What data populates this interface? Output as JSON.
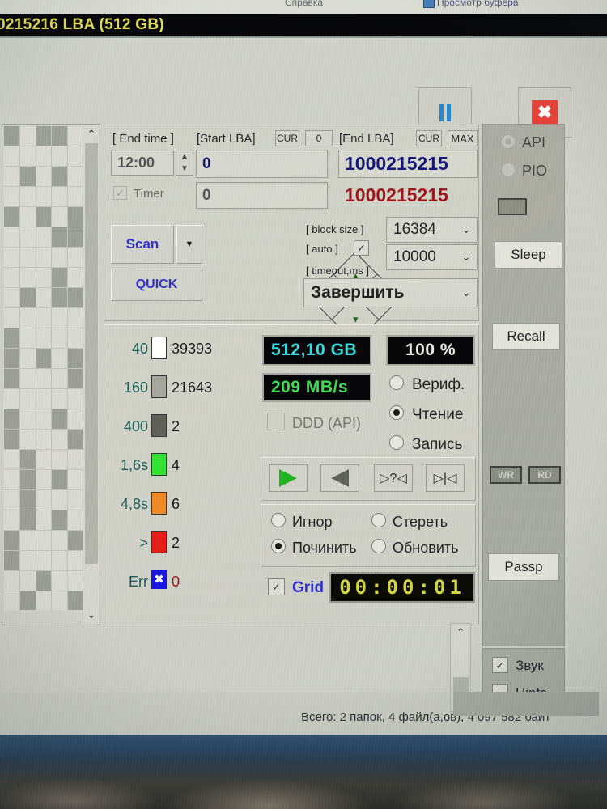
{
  "menu": {
    "help_label": "Справка",
    "buffer_label": "Просмотр буфера"
  },
  "titlebar": {
    "lba_text": "0215216 LBA (512 GB)"
  },
  "toolbar": {
    "pause_label": "Пауза",
    "stop_label": "Стоп",
    "pause_icon": "pause-icon",
    "stop_icon": "close-x-icon"
  },
  "scroll": {
    "up_glyph": "⌃",
    "down_glyph": "⌄"
  },
  "top_group": {
    "end_time_label": "[ End time ]",
    "end_time_value": "12:00",
    "timer_label": "Timer",
    "timer_checked": true,
    "start_lba_label": "[Start LBA]",
    "start_cur_label": "CUR",
    "start_zero_label": "0",
    "start_lba_value": "0",
    "start_lba_value2": "0",
    "end_lba_label": "[End LBA]",
    "end_cur_label": "CUR",
    "end_max_label": "MAX",
    "end_lba_value": "1000215215",
    "end_lba_value2": "1000215215",
    "scan_label": "Scan",
    "quick_label": "QUICK",
    "block_size_label": "[ block size ]",
    "auto_label": "[ auto ]",
    "auto_checked": true,
    "block_size_value": "16384",
    "timeout_label": "[ timeout,ms ]",
    "timeout_value": "10000",
    "finish_value": "Завершить",
    "dropdown_glyph": "⌄",
    "spin_up": "▲",
    "spin_down": "▼",
    "dpad": {
      "up": "▲",
      "down": "▼",
      "left": "◀",
      "right": "▶"
    }
  },
  "legend": {
    "rows": [
      {
        "threshold": "40",
        "color": "#ffffff",
        "count": "39393",
        "count_color": "#141414"
      },
      {
        "threshold": "160",
        "color": "#999a91",
        "count": "21643",
        "count_color": "#141414"
      },
      {
        "threshold": "400",
        "color": "#55564f",
        "count": "2",
        "count_color": "#141414"
      },
      {
        "threshold": "1,6s",
        "color": "#2ee02e",
        "count": "4",
        "count_color": "#141414"
      },
      {
        "threshold": "4,8s",
        "color": "#ef7c21",
        "count": "6",
        "count_color": "#141414"
      },
      {
        "threshold": ">",
        "color": "#e01b15",
        "count": "2",
        "count_color": "#141414"
      },
      {
        "threshold": "Err",
        "color": "#1414dd",
        "count": "0",
        "count_color": "#8f1418"
      }
    ],
    "err_glyph": "✖"
  },
  "readout": {
    "capacity": "512,10 GB",
    "speed": "209 MB/s",
    "percent": "100   %",
    "ddd_label": "DDD (API)",
    "ddd_checked": false,
    "mode_options": [
      {
        "label": "Вериф.",
        "selected": false
      },
      {
        "label": "Чтение",
        "selected": true
      },
      {
        "label": "Запись",
        "selected": false
      }
    ],
    "transport": [
      {
        "name": "play-forward-icon",
        "glyph": ""
      },
      {
        "name": "play-reverse-icon",
        "glyph": ""
      },
      {
        "name": "seek-query-icon",
        "glyph": "▷?◁"
      },
      {
        "name": "seek-start-icon",
        "glyph": "▷|◁"
      }
    ],
    "action_options": [
      {
        "label": "Игнор",
        "selected": false
      },
      {
        "label": "Починить",
        "selected": true
      },
      {
        "label": "Стереть",
        "selected": false
      },
      {
        "label": "Обновить",
        "selected": false
      }
    ],
    "grid_label": "Grid",
    "grid_checked": true,
    "elapsed": "00:00:01"
  },
  "sidebar": {
    "api_label": "API",
    "api_selected": true,
    "pio_label": "PIO",
    "pio_selected": false,
    "sleep_label": "Sleep",
    "recall_label": "Recall",
    "wr_label": "WR",
    "rd_label": "RD",
    "passp_label": "Passp",
    "sound_label": "Звук",
    "sound_checked": true,
    "hints_label": "Hints",
    "hints_checked": false
  },
  "statusbar": {
    "text": "Всего: 2 папок, 4 файл(а,ов), 4 097 582 байт"
  },
  "colors": {
    "accent_cyan": "#2fd8de",
    "accent_green": "#35d94a",
    "accent_yellow": "#dfd84a",
    "accent_blue": "#2b2bc8",
    "error_red": "#8f1418",
    "face": "#c9cabf"
  }
}
